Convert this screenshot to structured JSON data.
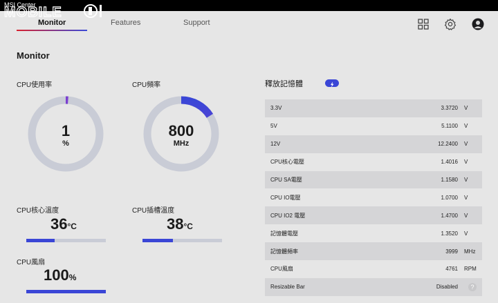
{
  "titlebar": {
    "app_title": "MSI Center",
    "watermark": "MOBILE01"
  },
  "nav": {
    "tabs": [
      {
        "label": "Monitor",
        "active": true
      },
      {
        "label": "Features",
        "active": false
      },
      {
        "label": "Support",
        "active": false
      }
    ],
    "icons": [
      "grid-icon",
      "gear-icon",
      "avatar-icon"
    ]
  },
  "page": {
    "title": "Monitor"
  },
  "gauges": {
    "cpu_usage": {
      "label": "CPU使用率",
      "value": "1",
      "unit": "%",
      "fraction": 0.01
    },
    "cpu_freq": {
      "label": "CPU頻率",
      "value": "800",
      "unit": "MHz",
      "fraction": 0.16
    }
  },
  "temps": {
    "cpu_core": {
      "label": "CPU核心溫度",
      "value": "36",
      "unit": "°C",
      "fraction": 0.36
    },
    "cpu_socket": {
      "label": "CPU插槽溫度",
      "value": "38",
      "unit": "°C",
      "fraction": 0.38
    },
    "cpu_fan": {
      "label": "CPU風扇",
      "value": "100",
      "unit": "%",
      "fraction": 1.0
    }
  },
  "memory": {
    "title": "釋放記憶體"
  },
  "voltages": [
    {
      "name": "3.3V",
      "value": "3.3720",
      "unit": "V"
    },
    {
      "name": "5V",
      "value": "5.1100",
      "unit": "V"
    },
    {
      "name": "12V",
      "value": "12.2400",
      "unit": "V"
    },
    {
      "name": "CPU核心電壓",
      "value": "1.4016",
      "unit": "V"
    },
    {
      "name": "CPU SA電壓",
      "value": "1.1580",
      "unit": "V"
    },
    {
      "name": "CPU IO電壓",
      "value": "1.0700",
      "unit": "V"
    },
    {
      "name": "CPU IO2 電壓",
      "value": "1.4700",
      "unit": "V"
    },
    {
      "name": "記憶體電壓",
      "value": "1.3520",
      "unit": "V"
    },
    {
      "name": "記憶體頻率",
      "value": "3999",
      "unit": "MHz"
    },
    {
      "name": "CPU風扇",
      "value": "4761",
      "unit": "RPM"
    },
    {
      "name": "Resizable Bar",
      "value": "Disabled",
      "unit": ""
    }
  ],
  "colors": {
    "accent": "#3a46d6",
    "gauge_track": "#c9ccd6",
    "gauge_fill_start": "#7b3fd0",
    "gauge_fill_end": "#3a46d6"
  }
}
